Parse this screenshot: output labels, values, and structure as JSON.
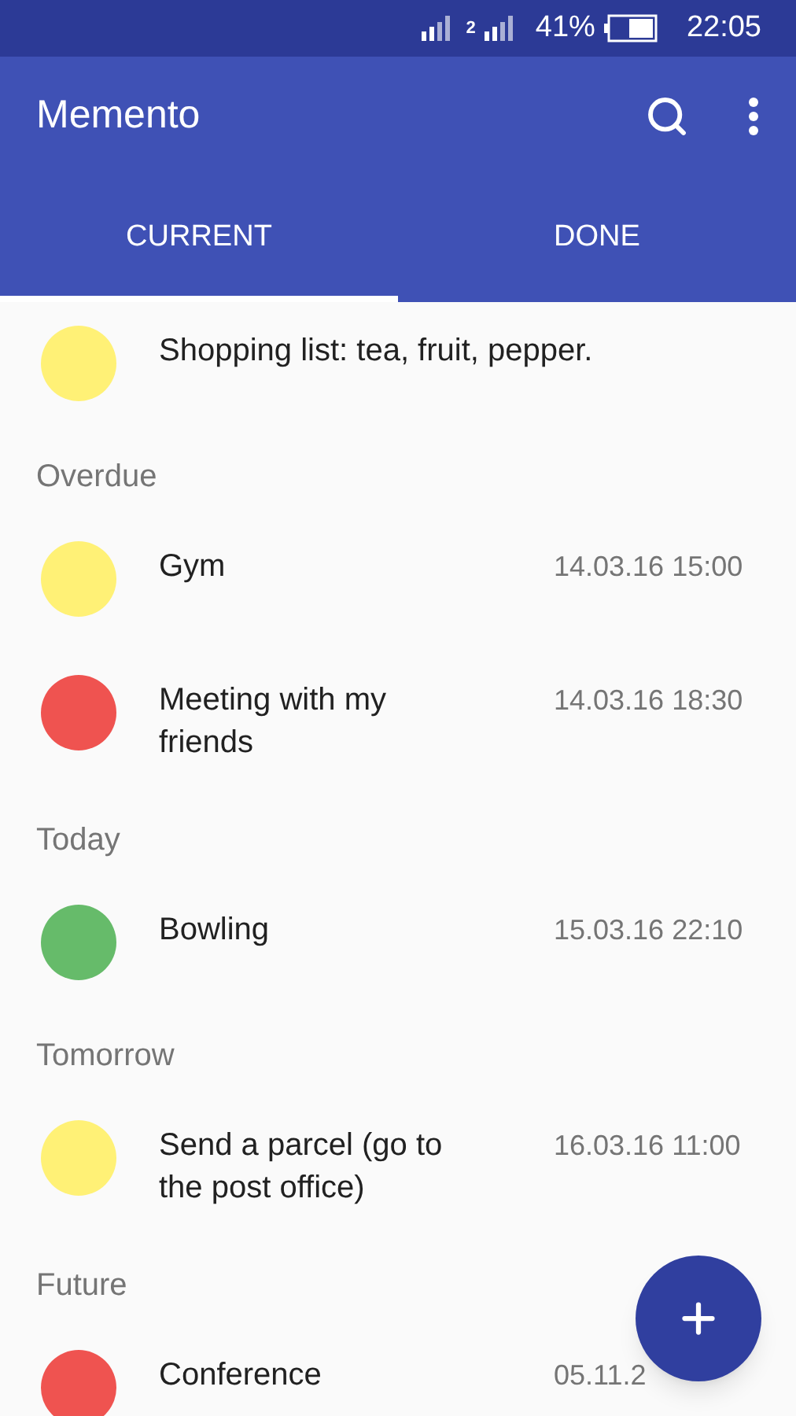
{
  "status_bar": {
    "sim_label": "2",
    "battery": "41%",
    "time": "22:05"
  },
  "app_bar": {
    "title": "Memento"
  },
  "tabs": [
    {
      "label": "CURRENT",
      "selected": true
    },
    {
      "label": "DONE",
      "selected": false
    }
  ],
  "list": [
    {
      "kind": "task",
      "title": "Shopping list: tea, fruit, pepper.",
      "color": "#fff176"
    },
    {
      "kind": "header",
      "title": "Overdue"
    },
    {
      "kind": "task",
      "title": "Gym",
      "time": "14.03.16 15:00",
      "color": "#fff176"
    },
    {
      "kind": "task",
      "title": "Meeting with my friends",
      "time": "14.03.16 18:30",
      "color": "#ef5350"
    },
    {
      "kind": "header",
      "title": "Today"
    },
    {
      "kind": "task",
      "title": "Bowling",
      "time": "15.03.16 22:10",
      "color": "#66bb6a"
    },
    {
      "kind": "header",
      "title": "Tomorrow"
    },
    {
      "kind": "task",
      "title": "Send a parcel (go to the post office)",
      "time": "16.03.16 11:00",
      "color": "#fff176"
    },
    {
      "kind": "header",
      "title": "Future"
    },
    {
      "kind": "task",
      "title": "Conference",
      "time": "05.11.2",
      "color": "#ef5350"
    }
  ]
}
